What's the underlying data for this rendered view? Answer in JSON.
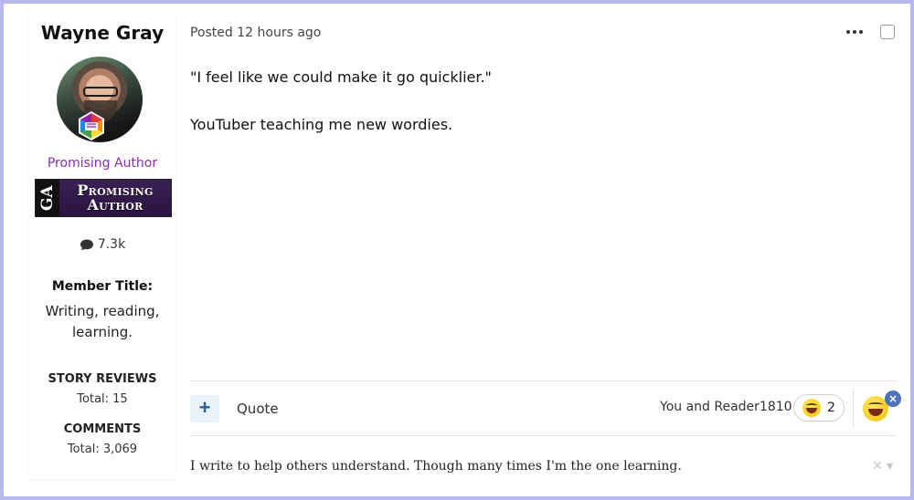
{
  "author": {
    "name": "Wayne Gray",
    "rank_text": "Promising Author",
    "rank_image_ga": "GA",
    "rank_image_line1": "Promising",
    "rank_image_line2": "Author",
    "post_count": "7.3k",
    "member_title_label": "Member Title:",
    "member_title": "Writing, reading, learning.",
    "stats": [
      {
        "label": "STORY REVIEWS",
        "value": "Total: 15"
      },
      {
        "label": "COMMENTS",
        "value": "Total: 3,069"
      }
    ]
  },
  "post": {
    "meta": "Posted 12 hours ago",
    "paragraphs": [
      "\"I feel like we could make it go quicklier.\"",
      "YouTuber teaching me new wordies."
    ],
    "plus_label": "+",
    "quote_label": "Quote",
    "reactions_who": "You and Reader1810",
    "reaction_count": "2",
    "remove_reaction_label": "×",
    "signature": "I write to help others understand.  Though many times I'm the one learning.",
    "signature_controls": "✕ ▾"
  },
  "colors": {
    "page_border": "#b9b8ec",
    "rank_text": "#8a2bb5",
    "plus_button_bg": "#e9f1fa",
    "react_badge": "#4d74b8"
  },
  "icons": {
    "more": "ellipsis-icon",
    "comment": "comment-bubble-icon",
    "reaction": "laughing-emoji-icon",
    "badge": "rank-hexagon-icon"
  }
}
